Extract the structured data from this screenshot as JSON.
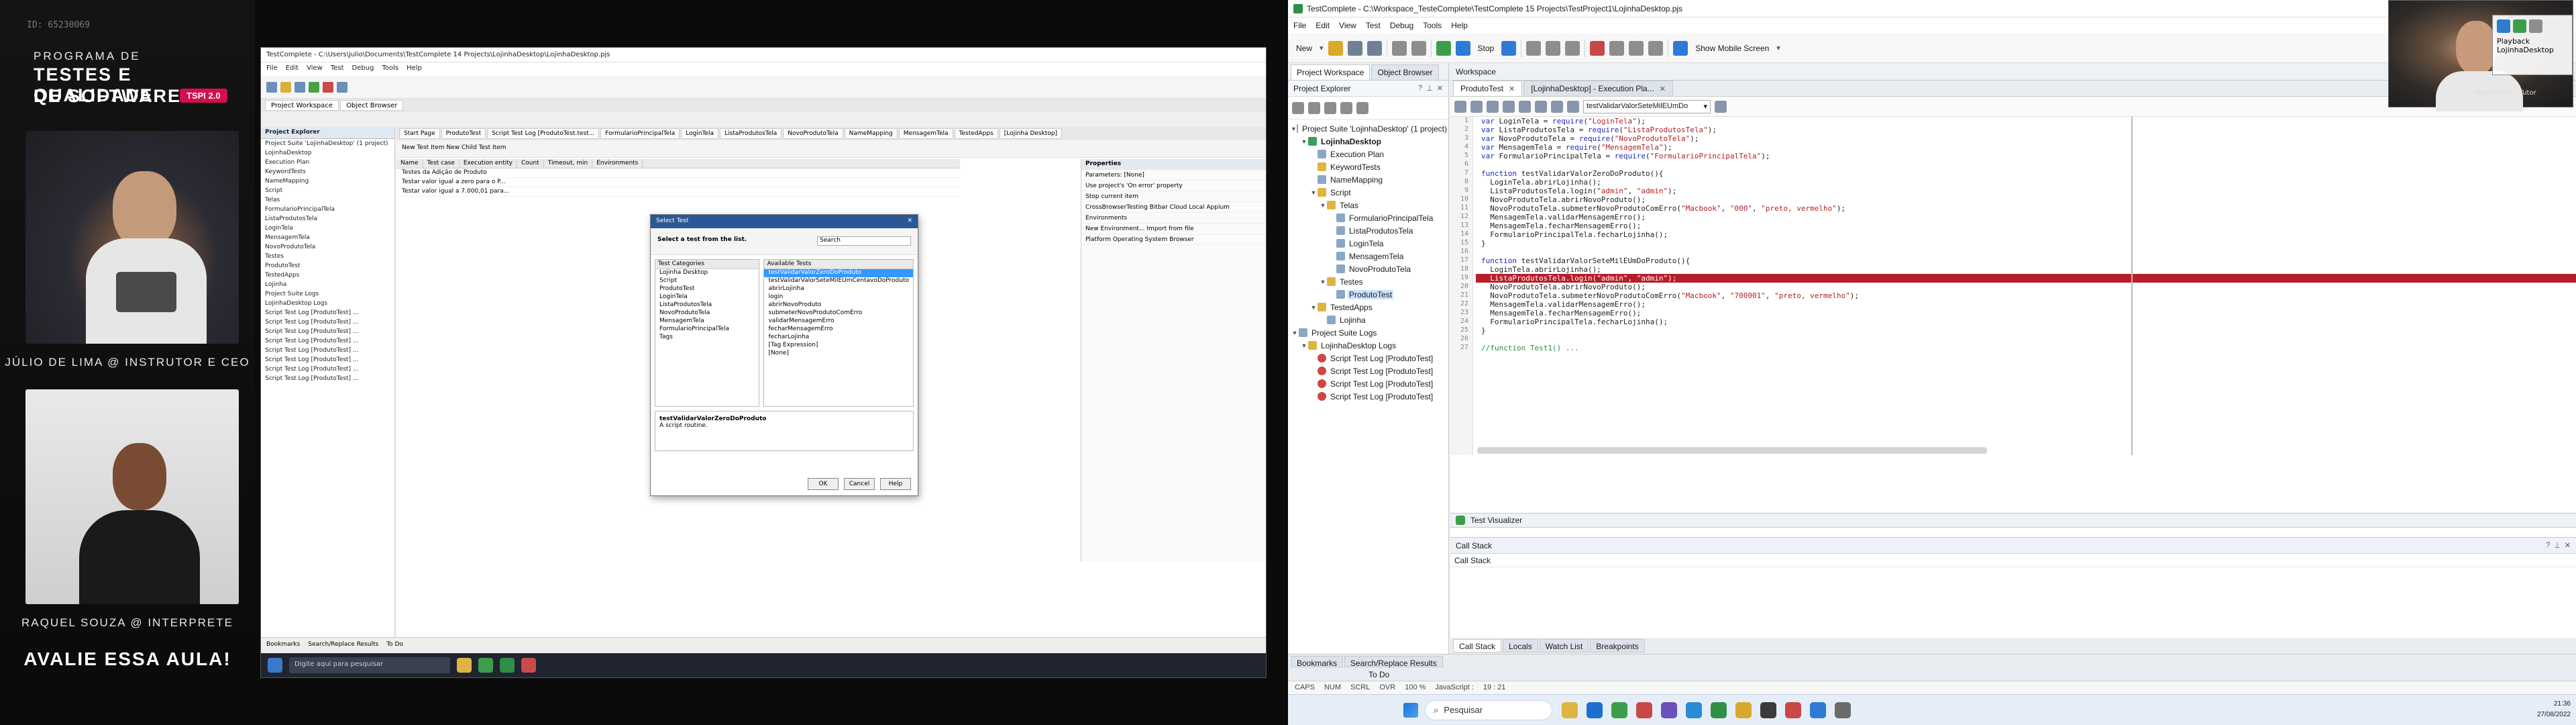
{
  "left": {
    "recording_id": "ID: 65230069",
    "brand": {
      "line1": "PROGRAMA DE",
      "line2": "TESTES E QUALIDADE",
      "line3": "DE SOFTWARE",
      "badge": "TSPI 2.0"
    },
    "instructor_tag": "JÚLIO DE LIMA @ INSTRUTOR E CEO",
    "interpreter_tag": "RAQUEL SOUZA @ INTERPRETE",
    "cta": "AVALIE ESSA AULA!",
    "rec": {
      "title": "TestComplete - C:\\Users\\julio\\Documents\\TestComplete 14 Projects\\LojinhaDesktop\\LojinhaDesktop.pjs",
      "menu": [
        "File",
        "Edit",
        "View",
        "Test",
        "Debug",
        "Tools",
        "Help"
      ],
      "tabs": [
        "Project Workspace",
        "Object Browser"
      ],
      "pe_title": "Project Explorer",
      "pe_lines": [
        "Project Suite 'LojinhaDesktop' (1 project)",
        "LojinhaDesktop",
        "Execution Plan",
        "KeywordTests",
        "NameMapping",
        "Script",
        "Telas",
        "FormularioPrincipalTela",
        "ListaProdutosTela",
        "LoginTela",
        "MensagemTela",
        "NovoProdutoTela",
        "Testes",
        "ProdutoTest",
        "TestedApps",
        "Lojinha",
        "Project Suite Logs",
        "LojinhaDesktop Logs",
        "Script Test Log [ProdutoTest] ...",
        "Script Test Log [ProdutoTest] ...",
        "Script Test Log [ProdutoTest] ...",
        "Script Test Log [ProdutoTest] ...",
        "Script Test Log [ProdutoTest] ...",
        "Script Test Log [ProdutoTest] ...",
        "Script Test Log [ProdutoTest] ...",
        "Script Test Log [ProdutoTest] ..."
      ],
      "ws_title": "Workspace",
      "ws_tabs": [
        "Start Page",
        "ProdutoTest",
        "Script Test Log [ProdutoTest.test...",
        "FormularioPrincipalTela",
        "LoginTela",
        "ListaProdutosTela",
        "NovoProdutoTela",
        "NameMapping",
        "MensagemTela",
        "TestedApps",
        "[Lojinha Desktop]"
      ],
      "ws_bar": "New Test Item    New Child Test Item",
      "grid_head": [
        "Name",
        "Test case",
        "Execution entity",
        "Count",
        "Timeout, min",
        "Environments"
      ],
      "grid_rows": [
        "Testes da Adição de Produto",
        "Testar valor igual a zero para o P...",
        "Testar valor igual a 7.000,01 para..."
      ],
      "props_title": "Properties",
      "props": [
        "Parameters:  [None]",
        "Use project's 'On error' property",
        "Stop current item",
        "CrossBrowserTesting   Bitbar Cloud   Local Appium",
        "Environments",
        "New Environment...   Import from file",
        "Platform   Operating System   Browser"
      ],
      "dialog": {
        "title": "Select Test",
        "subtitle": "Select a test from the list.",
        "search": "Search",
        "categories_head": "Test Categories",
        "categories": [
          "Lojinha Desktop",
          "Script",
          "ProdutoTest",
          "LoginTela",
          "ListaProdutosTela",
          "NovoProdutoTela",
          "MensagemTela",
          "FormularioPrincipalTela",
          "Tags"
        ],
        "tests_head": "Available Tests",
        "tests": [
          "testValidarValorZeroDoProduto",
          "testValidarValorSeteMilEUmCentavoDoProduto",
          "abrirLojinha",
          "login",
          "abrirNovoProduto",
          "submeterNovoProdutoComErro",
          "validarMensagemErro",
          "fecharMensagemErro",
          "fecharLojinha",
          "[Tag Expression]",
          "[None]"
        ],
        "desc_title": "testValidarValorZeroDoProduto",
        "desc_body": "A script routine.",
        "ok": "OK",
        "cancel": "Cancel",
        "help": "Help"
      },
      "bottom_tabs": [
        "Bookmarks",
        "Search/Replace Results",
        "To Do"
      ],
      "taskbar_search": "Digite aqui para pesquisar"
    }
  },
  "tc": {
    "title": "TestComplete - C:\\Workspace_TesteComplete\\TestComplete 15 Projects\\TestProject1\\LojinhaDesktop.pjs",
    "menu": [
      "File",
      "Edit",
      "View",
      "Test",
      "Debug",
      "Tools",
      "Help"
    ],
    "toolbar": {
      "new_label": "New",
      "stop_label": "Stop",
      "mobile_label": "Show Mobile Screen"
    },
    "pe": {
      "tab_workspace": "Project Workspace",
      "tab_browser": "Object Browser",
      "title": "Project Explorer",
      "tree": [
        {
          "label": "Project Suite 'LojinhaDesktop' (1 project)",
          "indent": 0,
          "icon": "doc",
          "tw": "▼"
        },
        {
          "label": "LojinhaDesktop",
          "indent": 1,
          "icon": "grn",
          "tw": "▼",
          "bold": true
        },
        {
          "label": "Execution Plan",
          "indent": 2,
          "icon": "doc",
          "tw": ""
        },
        {
          "label": "KeywordTests",
          "indent": 2,
          "icon": "fold",
          "tw": ""
        },
        {
          "label": "NameMapping",
          "indent": 2,
          "icon": "doc",
          "tw": ""
        },
        {
          "label": "Script",
          "indent": 2,
          "icon": "fold",
          "tw": "▼"
        },
        {
          "label": "Telas",
          "indent": 3,
          "icon": "fold",
          "tw": "▼"
        },
        {
          "label": "FormularioPrincipalTela",
          "indent": 4,
          "icon": "doc",
          "tw": ""
        },
        {
          "label": "ListaProdutosTela",
          "indent": 4,
          "icon": "doc",
          "tw": ""
        },
        {
          "label": "LoginTela",
          "indent": 4,
          "icon": "doc",
          "tw": ""
        },
        {
          "label": "MensagemTela",
          "indent": 4,
          "icon": "doc",
          "tw": ""
        },
        {
          "label": "NovoProdutoTela",
          "indent": 4,
          "icon": "doc",
          "tw": ""
        },
        {
          "label": "Testes",
          "indent": 3,
          "icon": "fold",
          "tw": "▼"
        },
        {
          "label": "ProdutoTest",
          "indent": 4,
          "icon": "doc",
          "tw": "",
          "sel": true
        },
        {
          "label": "TestedApps",
          "indent": 2,
          "icon": "fold",
          "tw": "▼"
        },
        {
          "label": "Lojinha",
          "indent": 3,
          "icon": "doc",
          "tw": ""
        },
        {
          "label": "Project Suite Logs",
          "indent": 0,
          "icon": "doc",
          "tw": "▼"
        },
        {
          "label": "LojinhaDesktop Logs",
          "indent": 1,
          "icon": "fold",
          "tw": "▼"
        },
        {
          "label": "Script Test Log [ProdutoTest]",
          "indent": 2,
          "icon": "red",
          "tw": ""
        },
        {
          "label": "Script Test Log [ProdutoTest]",
          "indent": 2,
          "icon": "red",
          "tw": ""
        },
        {
          "label": "Script Test Log [ProdutoTest]",
          "indent": 2,
          "icon": "red",
          "tw": ""
        },
        {
          "label": "Script Test Log [ProdutoTest]",
          "indent": 2,
          "icon": "red",
          "tw": ""
        }
      ]
    },
    "ws": {
      "title": "Workspace",
      "tabs": [
        {
          "label": "ProdutoTest",
          "active": true
        },
        {
          "label": "[LojinhaDesktop] - Execution Pla...",
          "active": false
        }
      ],
      "fn_combo": "testValidarValorSeteMilEUmDo",
      "code": [
        "var LoginTela = require(\"LoginTela\");",
        "var ListaProdutosTela = require(\"ListaProdutosTela\");",
        "var NovoProdutoTela = require(\"NovoProdutoTela\");",
        "var MensagemTela = require(\"MensagemTela\");",
        "var FormularioPrincipalTela = require(\"FormularioPrincipalTela\");",
        "",
        "function testValidarValorZeroDoProduto(){",
        "  LoginTela.abrirLojinha();",
        "  ListaProdutosTela.login(\"admin\", \"admin\");",
        "  NovoProdutoTela.abrirNovoProduto();",
        "  NovoProdutoTela.submeterNovoProdutoComErro(\"Macbook\", \"000\", \"preto, vermelho\");",
        "  MensagemTela.validarMensagemErro();",
        "  MensagemTela.fecharMensagemErro();",
        "  FormularioPrincipalTela.fecharLojinha();",
        "}",
        "",
        "function testValidarValorSeteMilEUmDoProduto(){",
        "  LoginTela.abrirLojinha();",
        "  ListaProdutosTela.login(\"admin\", \"admin\");",
        "  NovoProdutoTela.abrirNovoProduto();",
        "  NovoProdutoTela.submeterNovoProdutoComErro(\"Macbook\", \"700001\", \"preto, vermelho\");",
        "  MensagemTela.validarMensagemErro();",
        "  MensagemTela.fecharMensagemErro();",
        "  FormularioPrincipalTela.fecharLojinha();",
        "}",
        "",
        "//function Test1() ..."
      ],
      "highlight_line": 19,
      "test_visualizer": "Test Visualizer",
      "call_stack_title": "Call Stack",
      "call_stack_col": "Call Stack",
      "lower_tabs": [
        "Call Stack",
        "Locals",
        "Watch List",
        "Breakpoints"
      ]
    },
    "bottom_tabs": [
      "Bookmarks",
      "Search/Replace Results",
      "To Do"
    ],
    "to_do": "To Do",
    "status": [
      "CAPS",
      "NUM",
      "SCRL",
      "OVR",
      "100 %",
      "JavaScript :",
      "19 : 21"
    ],
    "taskbar": {
      "search": "Pesquisar",
      "time": "21:36",
      "date": "27/08/2022"
    },
    "pip_caption": "Kevin Lima - Tutor",
    "playback": {
      "label": "Playback",
      "app": "LojinhaDesktop"
    }
  }
}
